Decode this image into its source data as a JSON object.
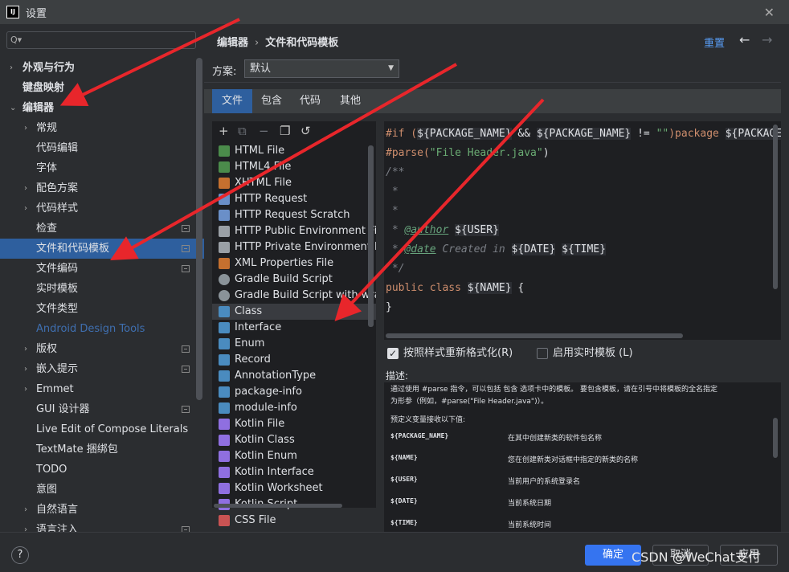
{
  "window": {
    "title": "设置",
    "logo": "IJ"
  },
  "sidebar": {
    "search_placeholder": "Q▾",
    "items": [
      {
        "label": "外观与行为",
        "arrow": "›",
        "bold": true
      },
      {
        "label": "键盘映射",
        "bold": true
      },
      {
        "label": "编辑器",
        "arrow": "⌄",
        "bold": true
      },
      {
        "label": "常规",
        "arrow": "›"
      },
      {
        "label": "代码编辑"
      },
      {
        "label": "字体"
      },
      {
        "label": "配色方案",
        "arrow": "›"
      },
      {
        "label": "代码样式",
        "arrow": "›"
      },
      {
        "label": "检查",
        "badge": true
      },
      {
        "label": "文件和代码模板",
        "badge": true,
        "selected": true
      },
      {
        "label": "文件编码",
        "badge": true
      },
      {
        "label": "实时模板"
      },
      {
        "label": "文件类型"
      },
      {
        "label": "Android Design Tools",
        "disabled": true
      },
      {
        "label": "版权",
        "arrow": "›",
        "badge": true
      },
      {
        "label": "嵌入提示",
        "arrow": "›",
        "badge": true
      },
      {
        "label": "Emmet",
        "arrow": "›"
      },
      {
        "label": "GUI 设计器",
        "badge": true
      },
      {
        "label": "Live Edit of Compose Literals"
      },
      {
        "label": "TextMate 捆绑包"
      },
      {
        "label": "TODO"
      },
      {
        "label": "意图"
      },
      {
        "label": "自然语言",
        "arrow": "›"
      },
      {
        "label": "语言注入",
        "arrow": "›",
        "badge": true
      }
    ]
  },
  "header": {
    "breadcrumb_root": "编辑器",
    "breadcrumb_sep": "›",
    "breadcrumb_current": "文件和代码模板",
    "reset": "重置",
    "back": "←",
    "forward": "→"
  },
  "scheme": {
    "label": "方案:",
    "value": "默认",
    "caret": "▼"
  },
  "tabs": [
    "文件",
    "包含",
    "代码",
    "其他"
  ],
  "toolbar": {
    "add": "+",
    "copy": "⧉",
    "remove": "−",
    "duplicate": "❐",
    "reset": "↺"
  },
  "files": [
    {
      "label": "HTML File",
      "icon": "html-icon",
      "color": "#4b8b4b"
    },
    {
      "label": "HTML4 File",
      "icon": "html-icon",
      "color": "#4b8b4b"
    },
    {
      "label": "XHTML File",
      "icon": "xhtml-icon",
      "color": "#c5702f"
    },
    {
      "label": "HTTP Request",
      "icon": "http-api-icon",
      "color": "#6a8fc8"
    },
    {
      "label": "HTTP Request Scratch",
      "icon": "http-api-icon",
      "color": "#6a8fc8"
    },
    {
      "label": "HTTP Public Environment File",
      "icon": "file-icon",
      "color": "#9aa0a6"
    },
    {
      "label": "HTTP Private Environment File",
      "icon": "file-icon",
      "color": "#9aa0a6"
    },
    {
      "label": "XML Properties File",
      "icon": "xml-icon",
      "color": "#c5702f"
    },
    {
      "label": "Gradle Build Script",
      "icon": "gradle-icon",
      "color": "#8a9399"
    },
    {
      "label": "Gradle Build Script with wrapp",
      "icon": "gradle-icon",
      "color": "#8a9399"
    },
    {
      "label": "Class",
      "icon": "java-class-icon",
      "color": "#4a8bbf",
      "selected": true
    },
    {
      "label": "Interface",
      "icon": "java-class-icon",
      "color": "#4a8bbf"
    },
    {
      "label": "Enum",
      "icon": "java-class-icon",
      "color": "#4a8bbf"
    },
    {
      "label": "Record",
      "icon": "java-class-icon",
      "color": "#4a8bbf"
    },
    {
      "label": "AnnotationType",
      "icon": "java-class-icon",
      "color": "#4a8bbf"
    },
    {
      "label": "package-info",
      "icon": "java-class-icon",
      "color": "#4a8bbf"
    },
    {
      "label": "module-info",
      "icon": "java-class-icon",
      "color": "#4a8bbf"
    },
    {
      "label": "Kotlin File",
      "icon": "kotlin-icon",
      "color": "#8f6fe0"
    },
    {
      "label": "Kotlin Class",
      "icon": "kotlin-icon",
      "color": "#8f6fe0"
    },
    {
      "label": "Kotlin Enum",
      "icon": "kotlin-icon",
      "color": "#8f6fe0"
    },
    {
      "label": "Kotlin Interface",
      "icon": "kotlin-icon",
      "color": "#8f6fe0"
    },
    {
      "label": "Kotlin Worksheet",
      "icon": "kotlin-icon",
      "color": "#8f6fe0"
    },
    {
      "label": "Kotlin Script",
      "icon": "kotlin-icon",
      "color": "#8f6fe0"
    },
    {
      "label": "CSS File",
      "icon": "css-icon",
      "color": "#c95353"
    }
  ],
  "code": {
    "l1_a": "#if (",
    "l1_b": "${PACKAGE_NAME}",
    "l1_c": " && ",
    "l1_d": "${PACKAGE_NAME}",
    "l1_e": " != ",
    "l1_f": "\"\"",
    "l1_g": ")package ",
    "l1_h": "${PACKAGE_NAME}",
    "l2_a": "#parse(",
    "l2_b": "\"File Header.java\"",
    "l2_c": ")",
    "l3": "/**",
    "l4": " *",
    "l5": " *",
    "l6_a": " * ",
    "l6_b": "@author",
    "l6_c": " ",
    "l6_d": "${USER}",
    "l7_a": " * ",
    "l7_b": "@date",
    "l7_c": " Created in ",
    "l7_d": "${DATE}",
    "l7_e": " ",
    "l7_f": "${TIME}",
    "l8": " */",
    "l9_a": "public class ",
    "l9_b": "${NAME}",
    "l9_c": " {",
    "l10": "}"
  },
  "options": {
    "reformat": "按照样式重新格式化(R)",
    "live_templates": "启用实时模板 (L)",
    "reformat_checked": true,
    "live_checked": false
  },
  "description": {
    "label": "描述:",
    "intro_1": "通过使用 #parse 指令，可以包括 包含 选项卡中的模板。 要包含模板，请在引号中将模板的全名指定",
    "intro_2": "为形参（例如，#parse(\"File Header.java\")）。",
    "predefined": "预定义变量接收以下值:",
    "vars": [
      {
        "name": "${PACKAGE_NAME}",
        "desc": "在其中创建新类的软件包名称"
      },
      {
        "name": "${NAME}",
        "desc": "您在创建新类对话框中指定的新类的名称"
      },
      {
        "name": "${USER}",
        "desc": "当前用户的系统登录名"
      },
      {
        "name": "${DATE}",
        "desc": "当前系统日期"
      },
      {
        "name": "${TIME}",
        "desc": "当前系统时间"
      }
    ]
  },
  "footer": {
    "help": "?",
    "ok": "确定",
    "cancel": "取消",
    "apply": "应用",
    "watermark": "CSDN @WeChat支付"
  }
}
